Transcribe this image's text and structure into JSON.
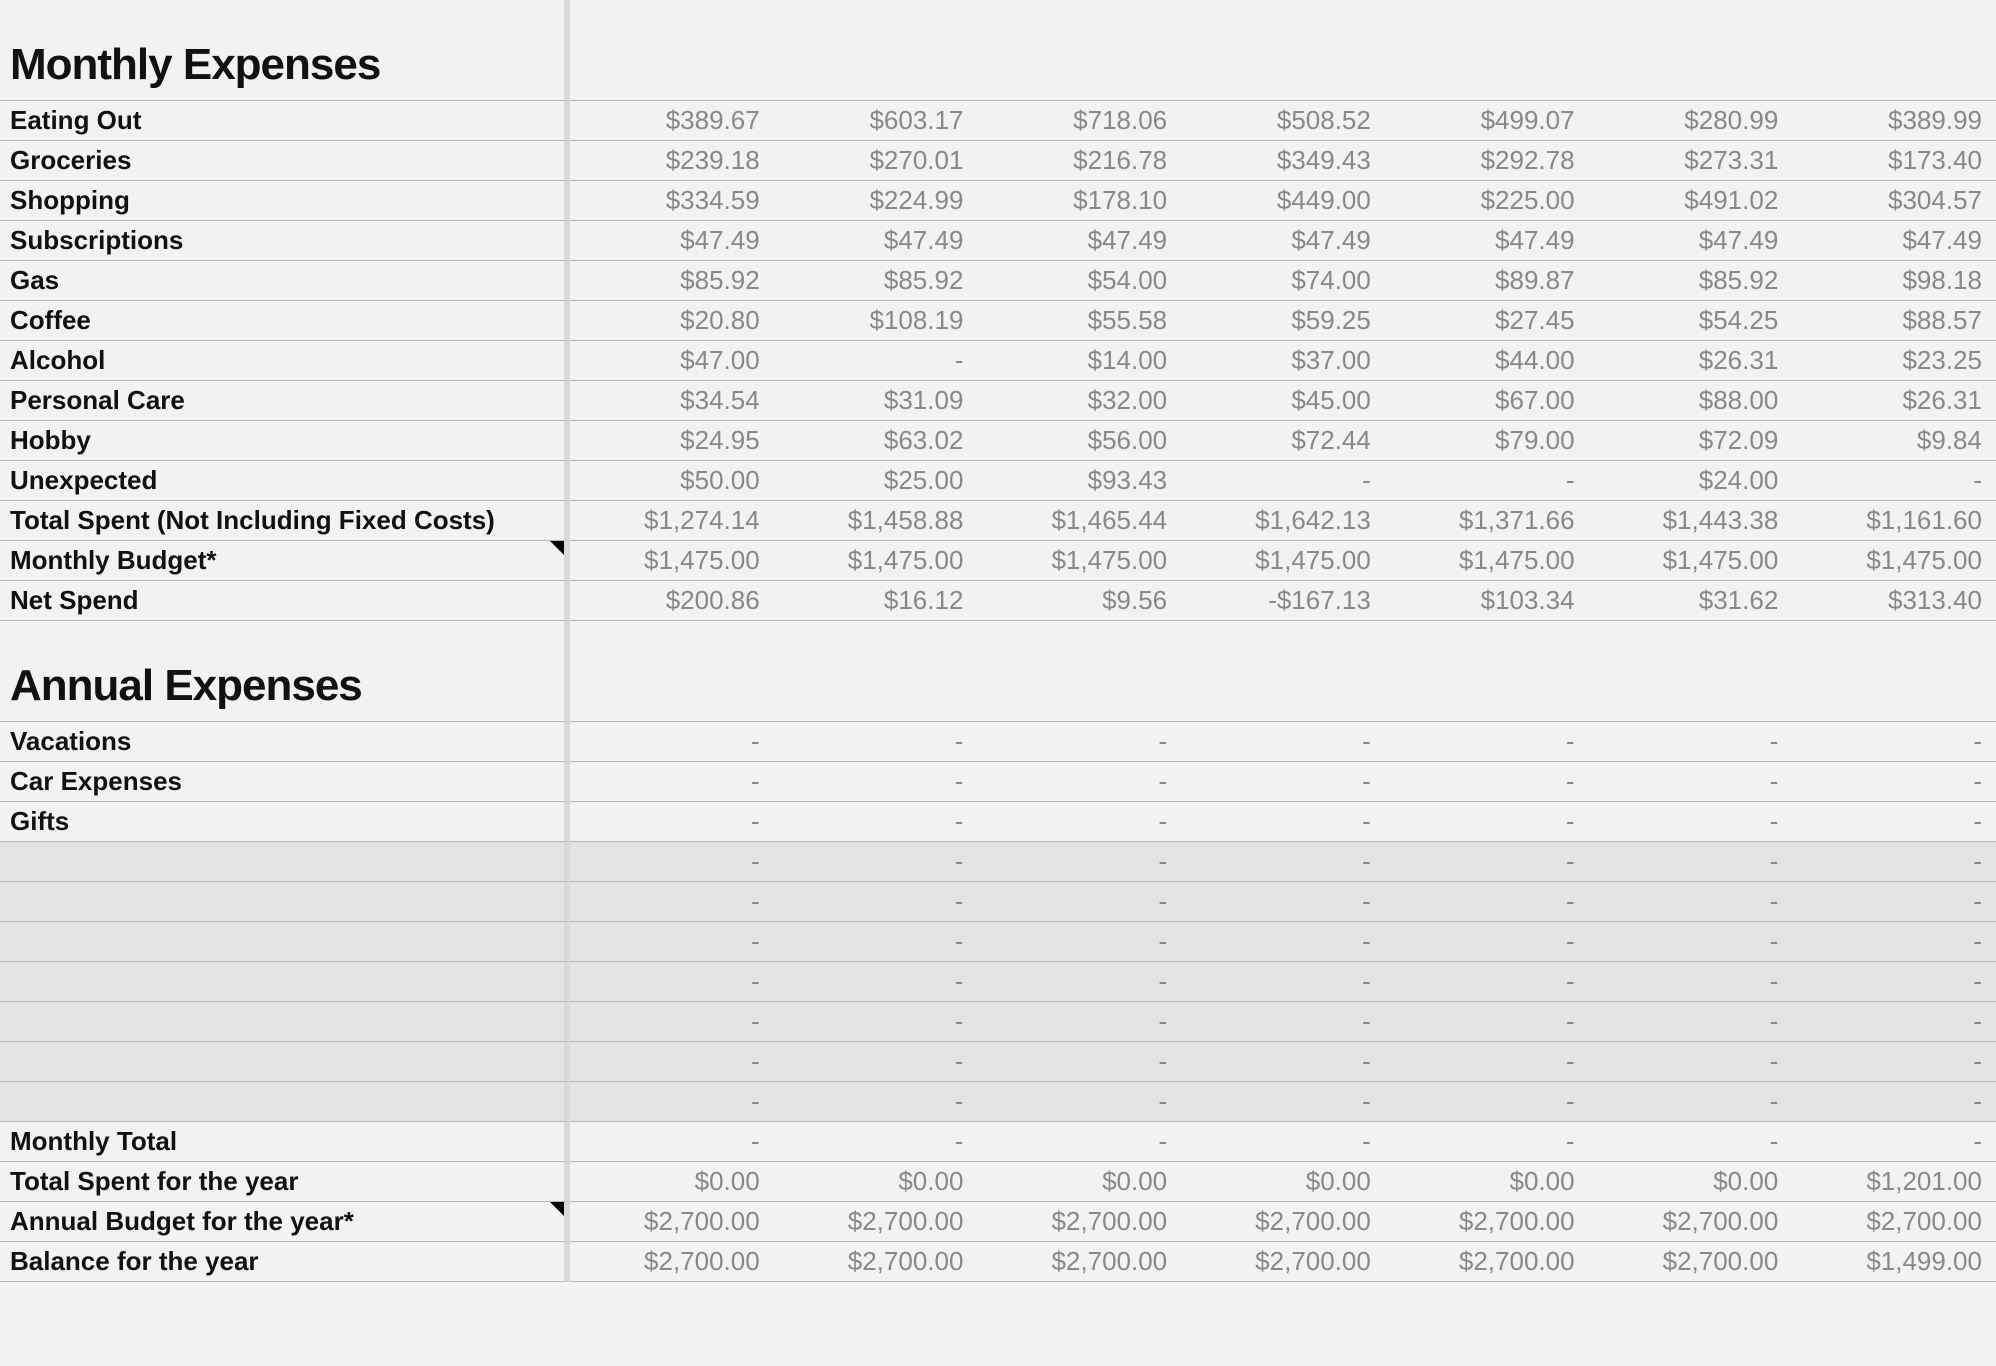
{
  "sections": {
    "monthly": {
      "title": "Monthly Expenses",
      "rows": [
        {
          "label": "Eating Out",
          "values": [
            "$389.67",
            "$603.17",
            "$718.06",
            "$508.52",
            "$499.07",
            "$280.99",
            "$389.99"
          ]
        },
        {
          "label": "Groceries",
          "values": [
            "$239.18",
            "$270.01",
            "$216.78",
            "$349.43",
            "$292.78",
            "$273.31",
            "$173.40"
          ]
        },
        {
          "label": "Shopping",
          "values": [
            "$334.59",
            "$224.99",
            "$178.10",
            "$449.00",
            "$225.00",
            "$491.02",
            "$304.57"
          ]
        },
        {
          "label": "Subscriptions",
          "values": [
            "$47.49",
            "$47.49",
            "$47.49",
            "$47.49",
            "$47.49",
            "$47.49",
            "$47.49"
          ]
        },
        {
          "label": "Gas",
          "values": [
            "$85.92",
            "$85.92",
            "$54.00",
            "$74.00",
            "$89.87",
            "$85.92",
            "$98.18"
          ]
        },
        {
          "label": "Coffee",
          "values": [
            "$20.80",
            "$108.19",
            "$55.58",
            "$59.25",
            "$27.45",
            "$54.25",
            "$88.57"
          ]
        },
        {
          "label": "Alcohol",
          "values": [
            "$47.00",
            "-",
            "$14.00",
            "$37.00",
            "$44.00",
            "$26.31",
            "$23.25"
          ]
        },
        {
          "label": "Personal Care",
          "values": [
            "$34.54",
            "$31.09",
            "$32.00",
            "$45.00",
            "$67.00",
            "$88.00",
            "$26.31"
          ]
        },
        {
          "label": "Hobby",
          "values": [
            "$24.95",
            "$63.02",
            "$56.00",
            "$72.44",
            "$79.00",
            "$72.09",
            "$9.84"
          ]
        },
        {
          "label": "Unexpected",
          "values": [
            "$50.00",
            "$25.00",
            "$93.43",
            "-",
            "-",
            "$24.00",
            "-"
          ]
        },
        {
          "label": "Total Spent (Not Including Fixed Costs)",
          "values": [
            "$1,274.14",
            "$1,458.88",
            "$1,465.44",
            "$1,642.13",
            "$1,371.66",
            "$1,443.38",
            "$1,161.60"
          ]
        },
        {
          "label": "Monthly Budget*",
          "corner": true,
          "values": [
            "$1,475.00",
            "$1,475.00",
            "$1,475.00",
            "$1,475.00",
            "$1,475.00",
            "$1,475.00",
            "$1,475.00"
          ]
        },
        {
          "label": "Net Spend",
          "values": [
            "$200.86",
            "$16.12",
            "$9.56",
            "-$167.13",
            "$103.34",
            "$31.62",
            "$313.40"
          ]
        }
      ]
    },
    "annual": {
      "title": "Annual Expenses",
      "rows": [
        {
          "label": "Vacations",
          "values": [
            "-",
            "-",
            "-",
            "-",
            "-",
            "-",
            "-"
          ]
        },
        {
          "label": "Car Expenses",
          "values": [
            "-",
            "-",
            "-",
            "-",
            "-",
            "-",
            "-"
          ]
        },
        {
          "label": "Gifts",
          "values": [
            "-",
            "-",
            "-",
            "-",
            "-",
            "-",
            "-"
          ]
        },
        {
          "label": "",
          "emptyDark": true,
          "values": [
            "-",
            "-",
            "-",
            "-",
            "-",
            "-",
            "-"
          ]
        },
        {
          "label": "",
          "emptyDark": true,
          "values": [
            "-",
            "-",
            "-",
            "-",
            "-",
            "-",
            "-"
          ]
        },
        {
          "label": "",
          "emptyDark": true,
          "values": [
            "-",
            "-",
            "-",
            "-",
            "-",
            "-",
            "-"
          ]
        },
        {
          "label": "",
          "emptyDark": true,
          "values": [
            "-",
            "-",
            "-",
            "-",
            "-",
            "-",
            "-"
          ]
        },
        {
          "label": "",
          "emptyDark": true,
          "values": [
            "-",
            "-",
            "-",
            "-",
            "-",
            "-",
            "-"
          ]
        },
        {
          "label": "",
          "emptyDark": true,
          "values": [
            "-",
            "-",
            "-",
            "-",
            "-",
            "-",
            "-"
          ]
        },
        {
          "label": "",
          "emptyDark": true,
          "values": [
            "-",
            "-",
            "-",
            "-",
            "-",
            "-",
            "-"
          ]
        },
        {
          "label": "Monthly Total",
          "values": [
            "-",
            "-",
            "-",
            "-",
            "-",
            "-",
            "-"
          ]
        },
        {
          "label": "Total Spent for the year",
          "values": [
            "$0.00",
            "$0.00",
            "$0.00",
            "$0.00",
            "$0.00",
            "$0.00",
            "$1,201.00"
          ]
        },
        {
          "label": "Annual Budget for the year*",
          "corner": true,
          "values": [
            "$2,700.00",
            "$2,700.00",
            "$2,700.00",
            "$2,700.00",
            "$2,700.00",
            "$2,700.00",
            "$2,700.00"
          ]
        },
        {
          "label": "Balance for the year",
          "values": [
            "$2,700.00",
            "$2,700.00",
            "$2,700.00",
            "$2,700.00",
            "$2,700.00",
            "$2,700.00",
            "$1,499.00"
          ]
        }
      ]
    }
  }
}
